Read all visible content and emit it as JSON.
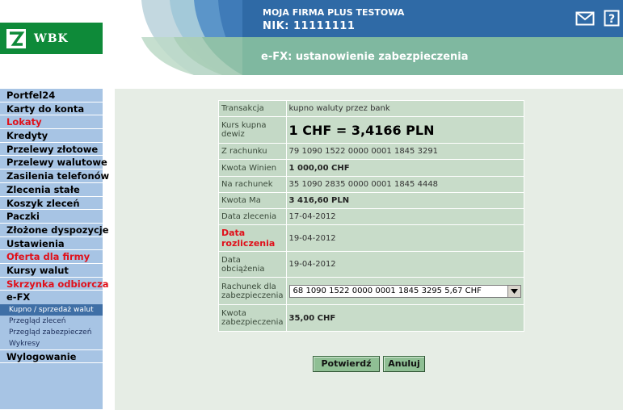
{
  "header": {
    "logo_text": "WBK",
    "company_name": "MOJA FIRMA PLUS TESTOWA",
    "nik": "NIK: 11111111",
    "page_title": "e-FX: ustanowienie zabezpieczenia",
    "icons": [
      "mail-icon",
      "help-icon"
    ]
  },
  "sidebar": {
    "items": [
      {
        "label": "Portfel24",
        "color": "black"
      },
      {
        "label": "Karty do konta",
        "color": "black"
      },
      {
        "label": "Lokaty",
        "color": "red"
      },
      {
        "label": "Kredyty",
        "color": "black"
      },
      {
        "label": "Przelewy złotowe",
        "color": "black"
      },
      {
        "label": "Przelewy walutowe",
        "color": "black"
      },
      {
        "label": "Zasilenia telefonów",
        "color": "black"
      },
      {
        "label": "Zlecenia stałe",
        "color": "black"
      },
      {
        "label": "Koszyk zleceń",
        "color": "black"
      },
      {
        "label": "Paczki",
        "color": "black"
      },
      {
        "label": "Złożone dyspozycje",
        "color": "black"
      },
      {
        "label": "Ustawienia",
        "color": "black"
      },
      {
        "label": "Oferta dla firmy",
        "color": "red"
      },
      {
        "label": "Kursy walut",
        "color": "black"
      },
      {
        "label": "Skrzynka odbiorcza",
        "color": "red"
      },
      {
        "label": "e-FX",
        "color": "black"
      }
    ],
    "subitems": [
      {
        "label": "Kupno / sprzedaż walut",
        "active": true
      },
      {
        "label": "Przegląd zleceń",
        "active": false
      },
      {
        "label": "Przegląd zabezpieczeń",
        "active": false
      },
      {
        "label": "Wykresy",
        "active": false
      }
    ],
    "logout": "Wylogowanie"
  },
  "form": {
    "transaction_label": "Transakcja",
    "transaction_value": "kupno waluty przez bank",
    "rate_label": "Kurs kupna dewiz",
    "rate_value": "1 CHF = 3,4166 PLN",
    "from_account_label": "Z rachunku",
    "from_account_value": "79 1090 1522 0000 0001 1845 3291",
    "amount_debit_label": "Kwota Winien",
    "amount_debit_value": "1 000,00 CHF",
    "to_account_label": "Na rachunek",
    "to_account_value": "35 1090 2835 0000 0001 1845 4448",
    "amount_credit_label": "Kwota Ma",
    "amount_credit_value": "3 416,60 PLN",
    "order_date_label": "Data zlecenia",
    "order_date_value": "17-04-2012",
    "settlement_date_label": "Data rozliczenia",
    "settlement_date_value": "19-04-2012",
    "charge_date_label": "Data obciążenia",
    "charge_date_value": "19-04-2012",
    "collateral_account_label": "Rachunek dla zabezpieczenia",
    "collateral_account_value": "68 1090 1522 0000 0001 1845 3295   5,67 CHF",
    "collateral_amount_label": "Kwota zabezpieczenia",
    "collateral_amount_value": "35,00 CHF"
  },
  "buttons": {
    "confirm": "Potwierdź",
    "cancel": "Anuluj"
  },
  "colors": {
    "brand_green": "#0e8a39",
    "header_teal": "#7fb8a0",
    "menu_blue": "#a7c4e4",
    "menu_active": "#3f6fa6",
    "panel_bg": "#e6ede5",
    "cell_bg": "#c8dcc9",
    "button_green": "#8fbf94",
    "red_text": "#e0101a"
  }
}
